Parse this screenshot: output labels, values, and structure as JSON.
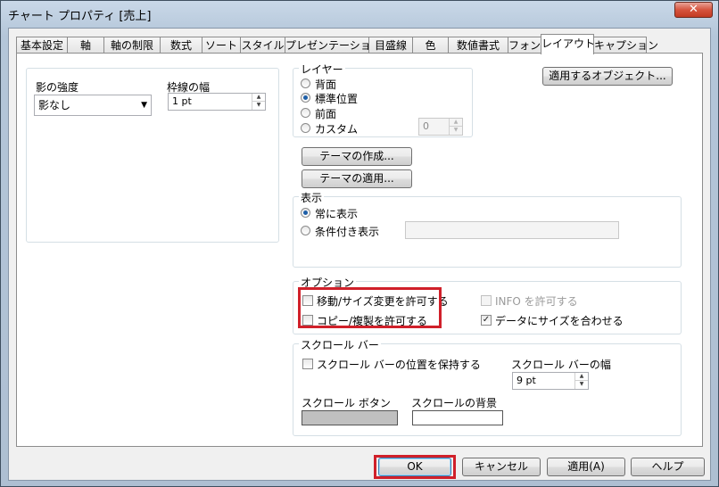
{
  "window": {
    "title": "チャート プロパティ [売上]",
    "close_glyph": "✕"
  },
  "tabs": [
    {
      "label": "基本設定"
    },
    {
      "label": "軸"
    },
    {
      "label": "軸の制限"
    },
    {
      "label": "数式"
    },
    {
      "label": "ソート"
    },
    {
      "label": "スタイル"
    },
    {
      "label": "プレゼンテーション"
    },
    {
      "label": "目盛線"
    },
    {
      "label": "色"
    },
    {
      "label": "数値書式"
    },
    {
      "label": "フォント"
    },
    {
      "label": "レイアウト"
    },
    {
      "label": "キャプション"
    }
  ],
  "active_tab": "レイアウト",
  "shadow": {
    "label": "影の強度",
    "value": "影なし"
  },
  "border_width": {
    "label": "枠線の幅",
    "value": "1 pt"
  },
  "layer": {
    "legend": "レイヤー",
    "options": [
      {
        "label": "背面",
        "selected": false
      },
      {
        "label": "標準位置",
        "selected": true
      },
      {
        "label": "前面",
        "selected": false
      },
      {
        "label": "カスタム",
        "selected": false
      }
    ],
    "custom_value": "0"
  },
  "apply_to_button": "適用するオブジェクト...",
  "theme_create_button": "テーマの作成...",
  "theme_apply_button": "テーマの適用...",
  "display": {
    "legend": "表示",
    "options": [
      {
        "label": "常に表示",
        "selected": true
      },
      {
        "label": "条件付き表示",
        "selected": false
      }
    ],
    "condition_value": ""
  },
  "options": {
    "legend": "オプション",
    "allow_move_resize": "移動/サイズ変更を許可する",
    "allow_copy": "コピー/複製を許可する",
    "allow_info": "INFO を許可する",
    "fit_to_data": "データにサイズを合わせる",
    "checked_mark": "✓"
  },
  "scrollbar": {
    "legend": "スクロール バー",
    "keep_position": "スクロール バーの位置を保持する",
    "width_label": "スクロール バーの幅",
    "width_value": "9 pt",
    "button_label": "スクロール ボタン",
    "bg_label": "スクロールの背景",
    "button_color": "#c0c0c0",
    "bg_color": "#ffffff"
  },
  "footer": {
    "ok": "OK",
    "cancel": "キャンセル",
    "apply": "適用(A)",
    "help": "ヘルプ"
  },
  "highlight_color": "#d0202a"
}
